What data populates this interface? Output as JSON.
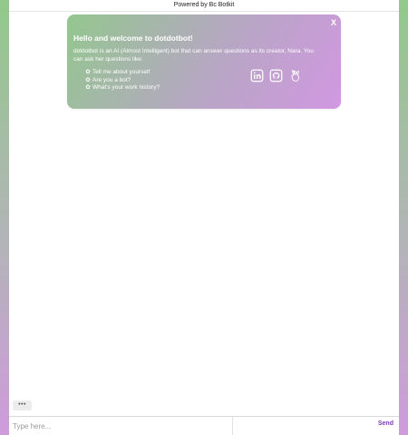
{
  "header": {
    "powered_by": "Powered by Bc Botkit"
  },
  "welcome": {
    "close_label": "X",
    "title": "Hello and welcome to dotdotbot!",
    "text": "dotdotbot is an AI (Almost Intelligent) bot that can answer questions as its creator, Nara. You can ask her questions like:",
    "questions": [
      "Tell me about yourself",
      "Are you a bot?",
      "What's your work history?"
    ],
    "social_icons": [
      "linkedin-icon",
      "github-icon",
      "angellist-icon"
    ]
  },
  "typing_indicator": "•••",
  "composer": {
    "placeholder": "Type here...",
    "value": "",
    "send_label": "Send"
  },
  "colors": {
    "gradient_top": "#92c98b",
    "gradient_bottom": "#cf9bdc",
    "send_accent": "#7a3db8"
  }
}
